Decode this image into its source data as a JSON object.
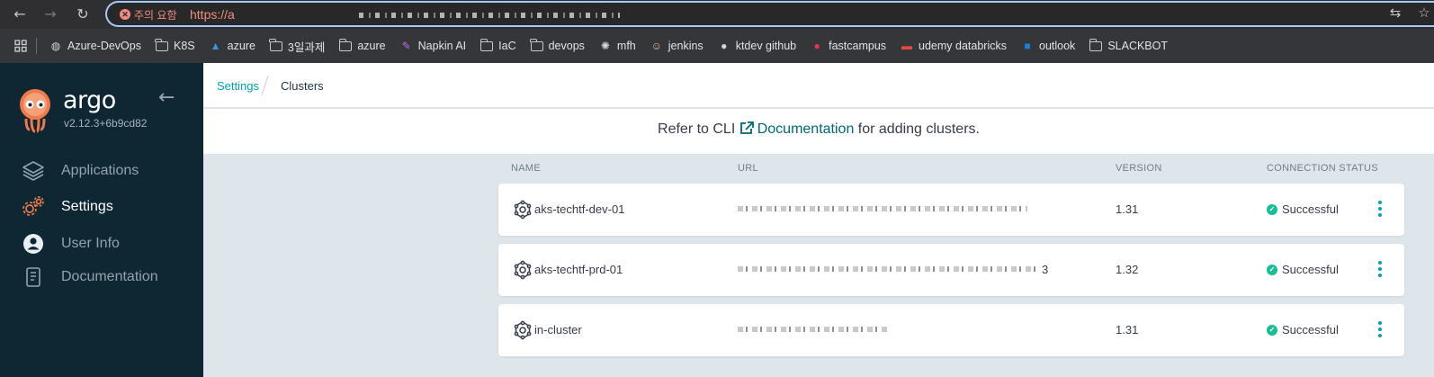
{
  "browser": {
    "warning_label": "주의 요함",
    "url_prefix": "https://a",
    "icons": [
      "back-arrow-icon",
      "forward-arrow-icon",
      "reload-icon",
      "translate-icon",
      "star-icon"
    ]
  },
  "bookmarks": [
    {
      "label": "Azure-DevOps",
      "icon": "globe-icon"
    },
    {
      "label": "K8S",
      "icon": "folder-icon"
    },
    {
      "label": "azure",
      "icon": "azure-icon"
    },
    {
      "label": "3일과제",
      "icon": "folder-icon"
    },
    {
      "label": "azure",
      "icon": "folder-icon"
    },
    {
      "label": "Napkin AI",
      "icon": "napkin-icon"
    },
    {
      "label": "IaC",
      "icon": "folder-icon"
    },
    {
      "label": "devops",
      "icon": "folder-icon"
    },
    {
      "label": "mfh",
      "icon": "openai-icon"
    },
    {
      "label": "jenkins",
      "icon": "jenkins-icon"
    },
    {
      "label": "ktdev github",
      "icon": "github-icon"
    },
    {
      "label": "fastcampus",
      "icon": "fastcampus-icon"
    },
    {
      "label": "udemy databricks",
      "icon": "udemy-icon"
    },
    {
      "label": "outlook",
      "icon": "outlook-icon"
    },
    {
      "label": "SLACKBOT",
      "icon": "folder-icon"
    }
  ],
  "sidebar": {
    "brand": "argo",
    "version": "v2.12.3+6b9cd82",
    "items": [
      {
        "label": "Applications",
        "icon": "layers-icon",
        "active": false
      },
      {
        "label": "Settings",
        "icon": "gears-icon",
        "active": true
      },
      {
        "label": "User Info",
        "icon": "user-icon",
        "active": false
      },
      {
        "label": "Documentation",
        "icon": "book-icon",
        "active": false
      }
    ]
  },
  "breadcrumb": {
    "parent": "Settings",
    "current": "Clusters"
  },
  "info": {
    "before": "Refer to CLI ",
    "link": "Documentation",
    "after": " for adding clusters."
  },
  "table": {
    "headers": {
      "name": "NAME",
      "url": "URL",
      "version": "VERSION",
      "status": "CONNECTION STATUS"
    },
    "rows": [
      {
        "name": "aks-techtf-dev-01",
        "url_suffix": "",
        "version": "1.31",
        "status": "Successful"
      },
      {
        "name": "aks-techtf-prd-01",
        "url_suffix": "3",
        "version": "1.32",
        "status": "Successful"
      },
      {
        "name": "in-cluster",
        "url_suffix": "",
        "version": "1.31",
        "status": "Successful"
      }
    ]
  },
  "colors": {
    "accent": "#00a2b3",
    "sidebar_bg": "#0f2633",
    "success": "#18be94",
    "logo": "#ef7b4d"
  }
}
